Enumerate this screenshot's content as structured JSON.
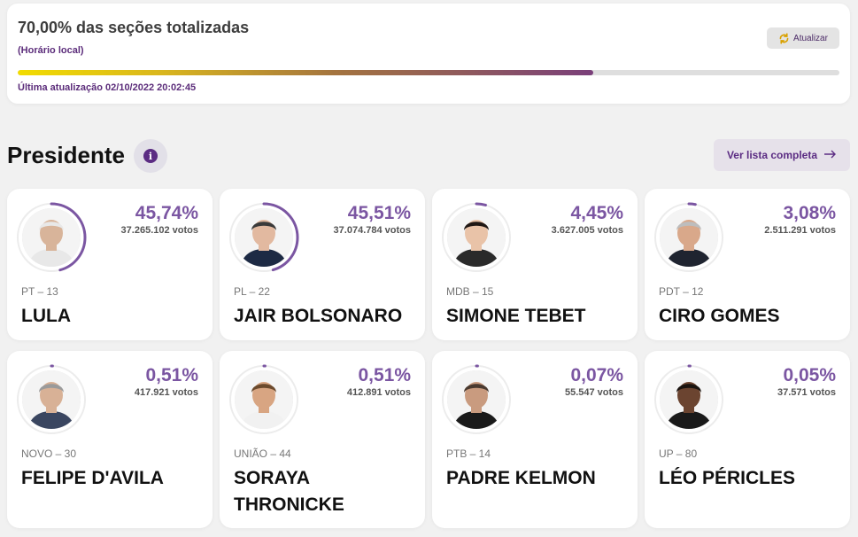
{
  "status": {
    "title": "70,00% das seções totalizadas",
    "subtitle": "(Horário local)",
    "refresh_label": "Atualizar",
    "progress": 0.7,
    "updated": "Última atualização 02/10/2022 20:02:45"
  },
  "section": {
    "title": "Presidente",
    "info_glyph": "i",
    "full_list_label": "Ver lista completa"
  },
  "colors": {
    "accent": "#7b56a2",
    "brand_purple": "#5b2c83",
    "progress_start": "#f2dc00",
    "progress_end": "#7a3f7a"
  },
  "candidates": [
    {
      "pct": "45,74%",
      "votes": "37.265.102 votos",
      "party": "PT – 13",
      "name": "LULA",
      "share": 45.74,
      "skin": "#d8b49a",
      "hair": "#e8e8e8",
      "shirt": "#e8e8e8"
    },
    {
      "pct": "45,51%",
      "votes": "37.074.784 votos",
      "party": "PL – 22",
      "name": "JAIR BOLSONARO",
      "share": 45.51,
      "skin": "#e2b9a0",
      "hair": "#3a3a3a",
      "shirt": "#1d2a44"
    },
    {
      "pct": "4,45%",
      "votes": "3.627.005 votos",
      "party": "MDB – 15",
      "name": "SIMONE TEBET",
      "share": 4.45,
      "skin": "#e9c3a8",
      "hair": "#1f1714",
      "shirt": "#2a2a2a"
    },
    {
      "pct": "3,08%",
      "votes": "2.511.291 votos",
      "party": "PDT – 12",
      "name": "CIRO GOMES",
      "share": 3.08,
      "skin": "#d9a88a",
      "hair": "#bdbdbd",
      "shirt": "#1f2430"
    },
    {
      "pct": "0,51%",
      "votes": "417.921 votos",
      "party": "NOVO – 30",
      "name": "FELIPE D'AVILA",
      "share": 0.51,
      "skin": "#d8b196",
      "hair": "#9a9a9a",
      "shirt": "#3a4660"
    },
    {
      "pct": "0,51%",
      "votes": "412.891 votos",
      "party": "UNIÃO – 44",
      "name": "SORAYA THRONICKE",
      "share": 0.51,
      "skin": "#d8a582",
      "hair": "#6b4a2d",
      "shirt": "#f1f1f1"
    },
    {
      "pct": "0,07%",
      "votes": "55.547 votos",
      "party": "PTB – 14",
      "name": "PADRE KELMON",
      "share": 0.07,
      "skin": "#c99b7f",
      "hair": "#4a3a30",
      "shirt": "#1a1a1a"
    },
    {
      "pct": "0,05%",
      "votes": "37.571 votos",
      "party": "UP – 80",
      "name": "LÉO PÉRICLES",
      "share": 0.05,
      "skin": "#6b4430",
      "hair": "#1a1410",
      "shirt": "#1a1a1a"
    }
  ]
}
